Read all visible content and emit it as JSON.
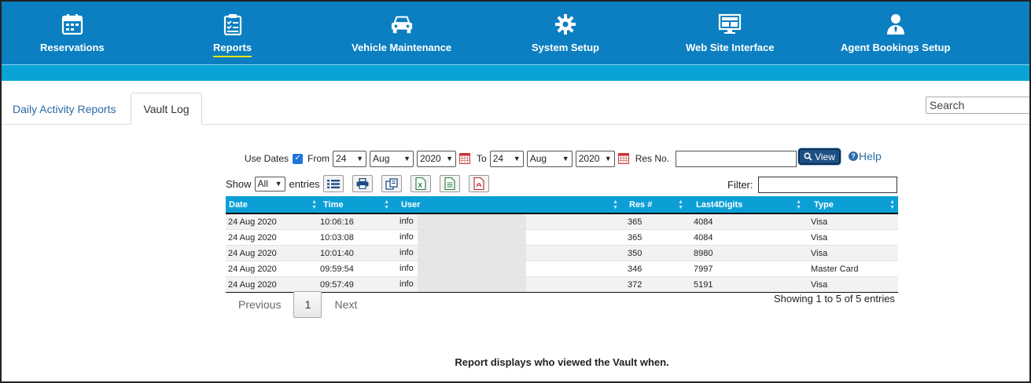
{
  "nav": {
    "items": [
      {
        "label": "Reservations",
        "icon": "calendar-icon"
      },
      {
        "label": "Reports",
        "icon": "clipboard-checklist-icon",
        "active": true
      },
      {
        "label": "Vehicle Maintenance",
        "icon": "car-icon"
      },
      {
        "label": "System Setup",
        "icon": "gear-icon"
      },
      {
        "label": "Web Site Interface",
        "icon": "monitor-icon"
      },
      {
        "label": "Agent Bookings Setup",
        "icon": "user-tie-icon"
      }
    ]
  },
  "tabs": [
    {
      "label": "Daily Activity Reports",
      "active": false
    },
    {
      "label": "Vault Log",
      "active": true
    }
  ],
  "search": {
    "placeholder": "Search"
  },
  "filters": {
    "use_dates_label": "Use Dates",
    "use_dates_checked": true,
    "from_label": "From",
    "from_day": "24",
    "from_month": "Aug",
    "from_year": "2020",
    "to_label": "To",
    "to_day": "24",
    "to_month": "Aug",
    "to_year": "2020",
    "res_no_label": "Res No.",
    "view_label": "View",
    "help_label": "Help"
  },
  "table_controls": {
    "show_label": "Show",
    "show_value": "All",
    "entries_label": "entries",
    "filter_label": "Filter:"
  },
  "table": {
    "columns": [
      "Date",
      "Time",
      "User",
      "Res #",
      "Last4Digits",
      "Type"
    ],
    "rows": [
      [
        "24 Aug 2020",
        "10:06:16",
        "info",
        "365",
        "4084",
        "Visa"
      ],
      [
        "24 Aug 2020",
        "10:03:08",
        "info",
        "365",
        "4084",
        "Visa"
      ],
      [
        "24 Aug 2020",
        "10:01:40",
        "info",
        "350",
        "8980",
        "Visa"
      ],
      [
        "24 Aug 2020",
        "09:59:54",
        "info",
        "346",
        "7997",
        "Master Card"
      ],
      [
        "24 Aug 2020",
        "09:57:49",
        "info",
        "372",
        "5191",
        "Visa"
      ]
    ]
  },
  "pagination": {
    "previous": "Previous",
    "page": "1",
    "next": "Next",
    "info": "Showing 1 to 5 of 5 entries"
  },
  "footer": {
    "note": "Report displays who viewed the Vault when."
  },
  "colors": {
    "nav_bg": "#0b7fc1",
    "subbar": "#09a3d6",
    "table_header": "#0b9fd6",
    "active_underline": "#e6e600"
  }
}
